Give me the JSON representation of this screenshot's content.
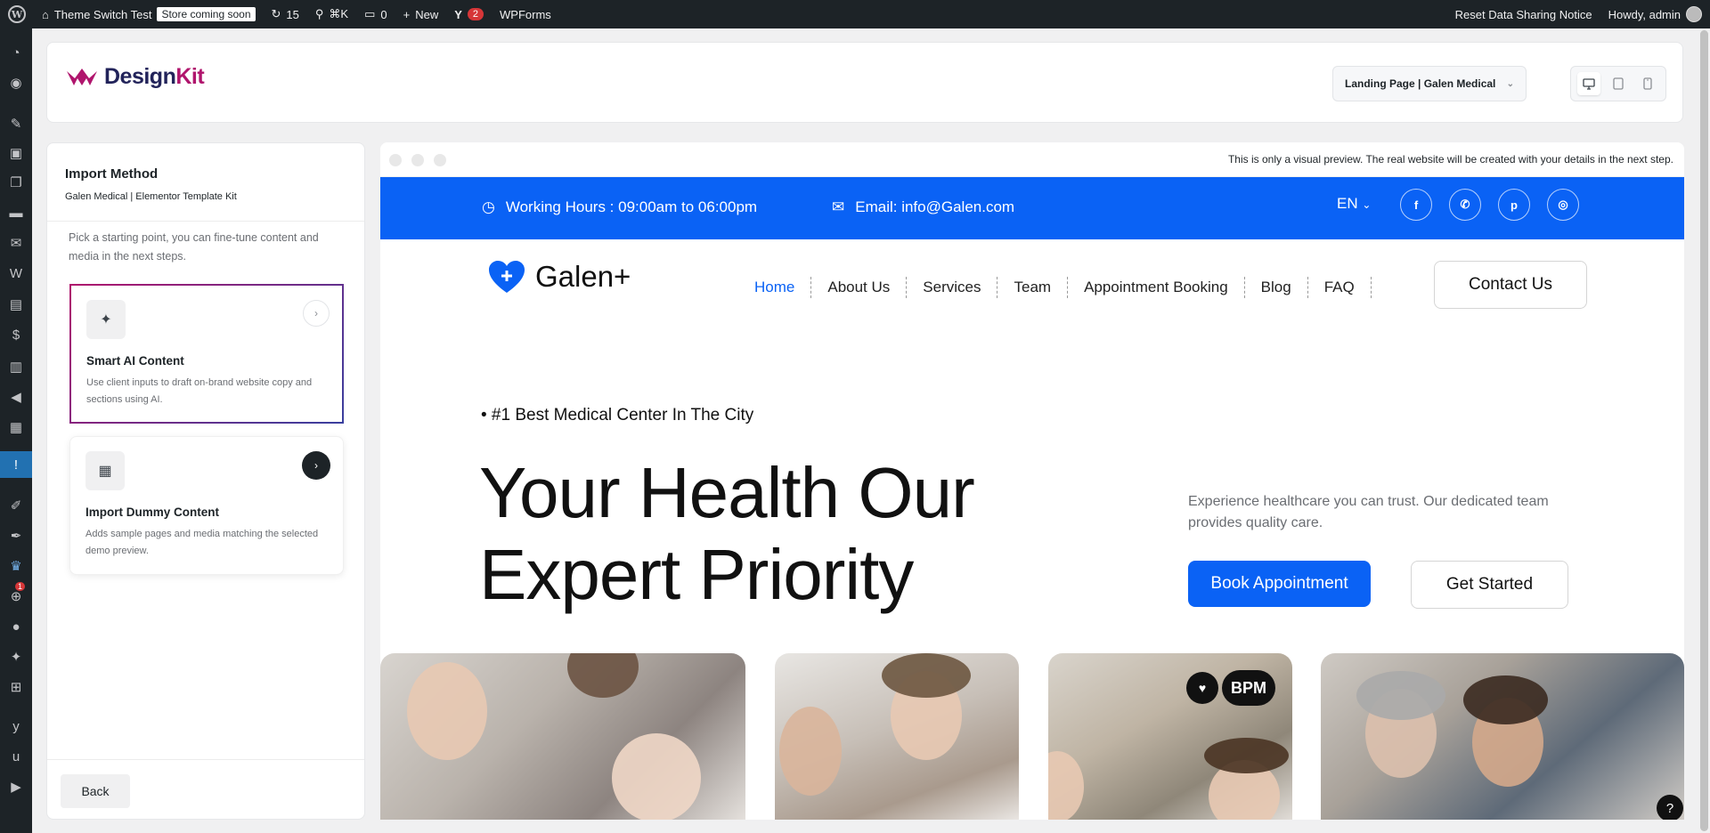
{
  "admin_bar": {
    "site_name": "Theme Switch Test",
    "store_badge": "Store coming soon",
    "updates_count": "15",
    "search_shortcut": "⌘K",
    "comments_count": "0",
    "new_label": "New",
    "yoast_count": "2",
    "wpforms_label": "WPForms",
    "reset_notice": "Reset Data Sharing Notice",
    "greeting": "Howdy, admin"
  },
  "sidebar": {
    "badge_count": "1",
    "icons": [
      "dashboard-icon",
      "elementor-icon",
      "posts-icon",
      "media-icon",
      "pages-icon",
      "comments-icon",
      "email-icon",
      "woocommerce-icon",
      "products-icon",
      "payments-icon",
      "analytics-icon",
      "marketing-icon",
      "templates-icon",
      "active-plugin-icon",
      "appearance-icon",
      "customizer-icon",
      "designkit-icon",
      "plugins-icon",
      "users-icon",
      "tools-icon",
      "settings-icon",
      "yoast-icon",
      "ultimate-icon",
      "video-icon"
    ]
  },
  "header": {
    "logo_main": "Design",
    "logo_accent": "Kit",
    "template_select": "Landing Page | Galen Medical",
    "brand_color": "#b0156d"
  },
  "left_panel": {
    "title": "Import Method",
    "subtitle": "Galen Medical | Elementor Template Kit",
    "description": "Pick a starting point, you can fine-tune content and media in the next steps.",
    "cards": [
      {
        "title": "Smart AI Content",
        "description": "Use client inputs to draft on-brand website copy and sections using AI.",
        "icon": "sparkles-icon"
      },
      {
        "title": "Import Dummy Content",
        "description": "Adds sample pages and media matching the selected demo preview.",
        "icon": "layout-icon"
      }
    ],
    "back_label": "Back"
  },
  "preview": {
    "notice": "This is only a visual preview. The real website will be created with your details in the next step.",
    "site": {
      "hours": "Working Hours : 09:00am to 06:00pm",
      "email": "Email: info@Galen.com",
      "language": "EN",
      "social": [
        "facebook-icon",
        "whatsapp-icon",
        "pinterest-icon",
        "instagram-icon"
      ],
      "brand": "Galen+",
      "nav": [
        "Home",
        "About Us",
        "Services",
        "Team",
        "Appointment Booking",
        "Blog",
        "FAQ"
      ],
      "contact_label": "Contact Us",
      "tag": "• #1 Best Medical Center In The City",
      "hero_line1": "Your Health Our",
      "hero_line2": "Expert Priority",
      "hero_desc": "Experience healthcare you can trust. Our dedicated team provides quality care.",
      "book_label": "Book Appointment",
      "start_label": "Get Started",
      "bpm_label": "BPM",
      "accent_color": "#0a62f5"
    },
    "help_label": "?"
  }
}
